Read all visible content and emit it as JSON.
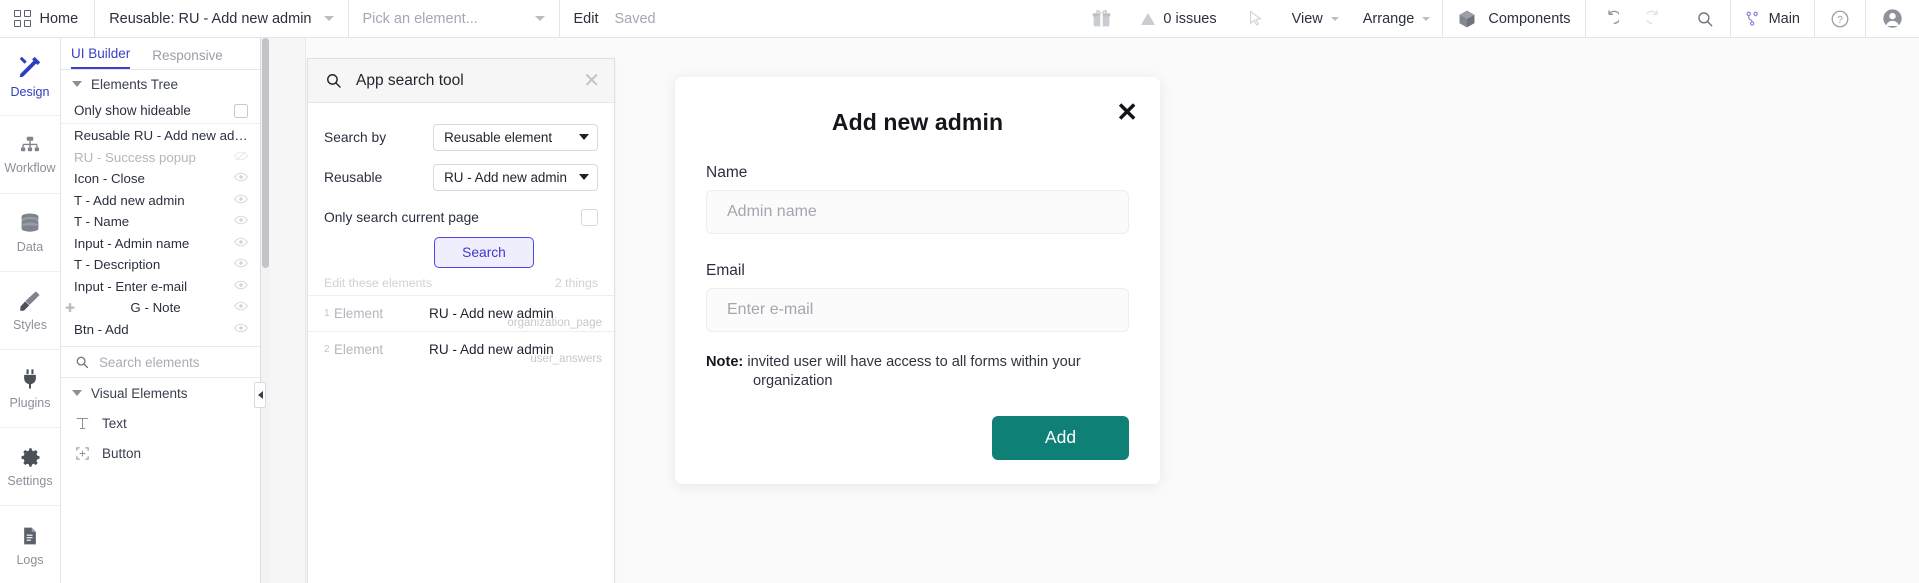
{
  "topbar": {
    "home_label": "Home",
    "page_select": "Reusable: RU - Add new admin",
    "element_select": "Pick an element...",
    "edit_label": "Edit",
    "saved_label": "Saved",
    "issues_label": "0 issues",
    "view_label": "View",
    "arrange_label": "Arrange",
    "components_label": "Components",
    "branch_label": "Main"
  },
  "rail": {
    "items": [
      {
        "label": "Design",
        "icon": "design-icon"
      },
      {
        "label": "Workflow",
        "icon": "workflow-icon"
      },
      {
        "label": "Data",
        "icon": "data-icon"
      },
      {
        "label": "Styles",
        "icon": "styles-icon"
      },
      {
        "label": "Plugins",
        "icon": "plugins-icon"
      },
      {
        "label": "Settings",
        "icon": "settings-icon"
      },
      {
        "label": "Logs",
        "icon": "logs-icon"
      }
    ]
  },
  "left_panel": {
    "tabs": [
      {
        "label": "UI Builder",
        "active": true
      },
      {
        "label": "Responsive",
        "active": false
      }
    ],
    "section_title": "Elements Tree",
    "only_show_hideable": "Only show hideable",
    "tree": [
      {
        "label": "Reusable RU - Add new admin",
        "dim": false,
        "eye": false,
        "plus": false
      },
      {
        "label": "RU - Success popup",
        "dim": true,
        "eye": true,
        "plus": false
      },
      {
        "label": "Icon - Close",
        "dim": false,
        "eye": true,
        "plus": false
      },
      {
        "label": "T - Add new admin",
        "dim": false,
        "eye": true,
        "plus": false
      },
      {
        "label": "T - Name",
        "dim": false,
        "eye": true,
        "plus": false
      },
      {
        "label": "Input - Admin name",
        "dim": false,
        "eye": true,
        "plus": false
      },
      {
        "label": "T - Description",
        "dim": false,
        "eye": true,
        "plus": false
      },
      {
        "label": "Input - Enter e-mail",
        "dim": false,
        "eye": true,
        "plus": false
      },
      {
        "label": "G - Note",
        "dim": false,
        "eye": true,
        "plus": true
      },
      {
        "label": "Btn - Add",
        "dim": false,
        "eye": true,
        "plus": false
      }
    ],
    "search_placeholder": "Search elements",
    "visual_elements_title": "Visual Elements",
    "visual_elements": [
      {
        "label": "Text",
        "icon": "text-icon"
      },
      {
        "label": "Button",
        "icon": "button-icon"
      }
    ]
  },
  "search_tool": {
    "title": "App search tool",
    "search_by_label": "Search by",
    "search_by_value": "Reusable element",
    "reusable_label": "Reusable",
    "reusable_value": "RU - Add new admin",
    "only_current_page_label": "Only search current page",
    "search_button": "Search",
    "edit_hint": "Edit these elements",
    "count_label": "2 things",
    "results": [
      {
        "index": "1",
        "kind": "Element",
        "name": "RU - Add new admin",
        "location": "organization_page"
      },
      {
        "index": "2",
        "kind": "Element",
        "name": "RU - Add new admin",
        "location": "user_answers"
      }
    ]
  },
  "modal": {
    "title": "Add new admin",
    "name_label": "Name",
    "name_placeholder": "Admin name",
    "email_label": "Email",
    "email_placeholder": "Enter e-mail",
    "note_prefix": "Note:",
    "note_line1": "invited user will have access to all forms within your",
    "note_line2": "organization",
    "add_button": "Add",
    "accent_color": "#0e8076"
  }
}
